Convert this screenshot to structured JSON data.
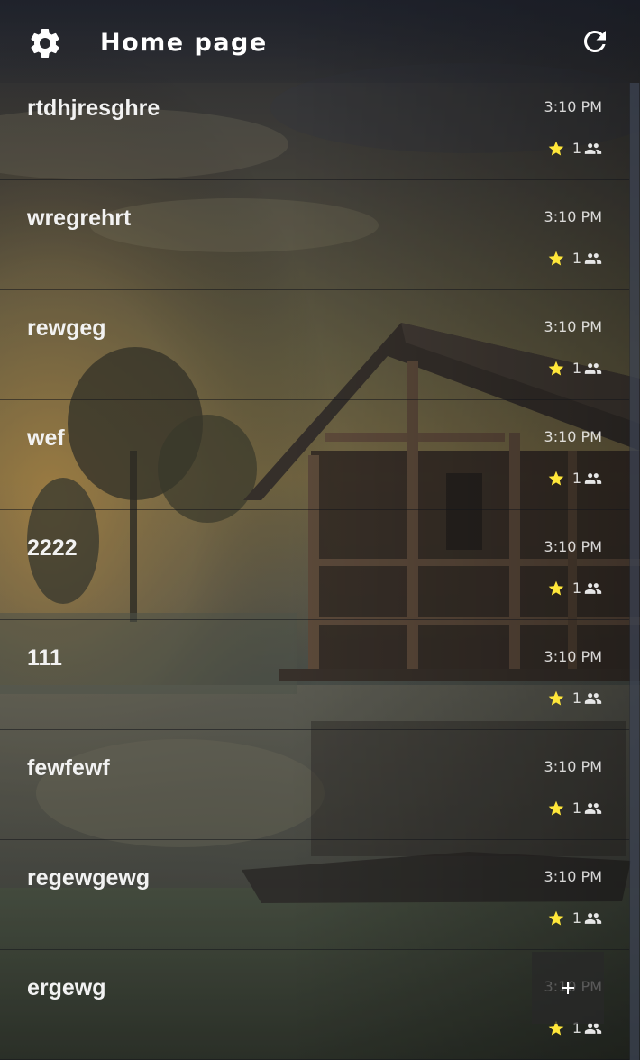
{
  "header": {
    "title": "Home page",
    "settings_icon": "gear-icon",
    "refresh_icon": "refresh-icon"
  },
  "items": [
    {
      "title": "rtdhjresghre",
      "time": "3:10 PM",
      "count": "1"
    },
    {
      "title": "wregrehrt",
      "time": "3:10 PM",
      "count": "1"
    },
    {
      "title": "rewgeg",
      "time": "3:10 PM",
      "count": "1"
    },
    {
      "title": "wef",
      "time": "3:10 PM",
      "count": "1"
    },
    {
      "title": "2222",
      "time": "3:10 PM",
      "count": "1"
    },
    {
      "title": "111",
      "time": "3:10 PM",
      "count": "1"
    },
    {
      "title": "fewfewf",
      "time": "3:10 PM",
      "count": "1"
    },
    {
      "title": "regewgewg",
      "time": "3:10 PM",
      "count": "1"
    },
    {
      "title": "ergewg",
      "time": "3:10 PM",
      "count": "1"
    }
  ],
  "icons": {
    "star": "star-icon",
    "members": "people-icon",
    "fab": "plus-icon"
  },
  "colors": {
    "star": "#ffe73a",
    "text": "#ffffff",
    "divider": "#15171c"
  }
}
